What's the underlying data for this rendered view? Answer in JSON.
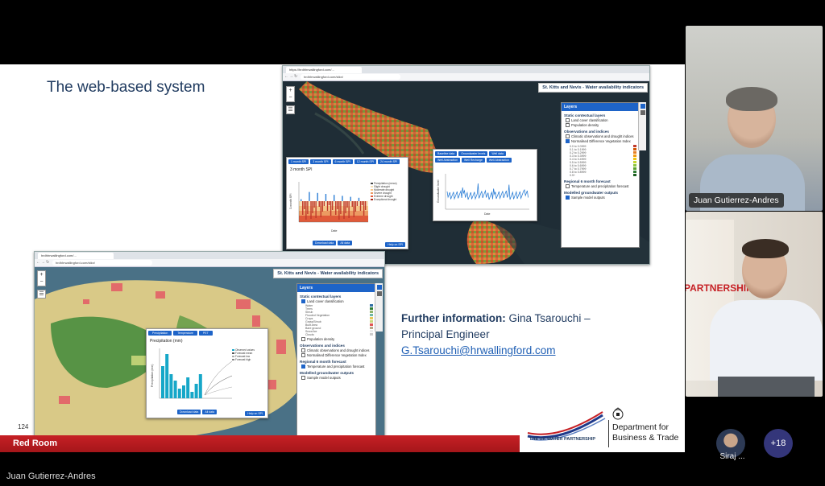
{
  "slide": {
    "title": "The web-based system",
    "page_number": "124",
    "room_label": "Red Room",
    "further_label": "Further information:",
    "contact_name": "Gina Tsarouchi –",
    "contact_role": "Principal Engineer",
    "contact_email": "G.Tsarouchi@hrwallingford.com",
    "logo_ukwp": "THE UK WATER PARTNERSHIP",
    "logo_dbt_line1": "Department for",
    "logo_dbt_line2": "Business & Trade"
  },
  "screenshot_top": {
    "tab_title": "https://hrdhhrwallingford.com/...",
    "url": "hrdhhrwallingford.com/stkn/",
    "header": "St. Kitts and Nevis - Water availability indicators",
    "layers_title": "Layers",
    "sections": [
      {
        "title": "Static contextual layers",
        "items": [
          "Land cover classification",
          "Population density"
        ]
      },
      {
        "title": "Observations and indices",
        "items": [
          "Climatic observations and drought indices",
          "Normalised Difference Vegetation Index"
        ]
      },
      {
        "title": "Regional 6 month forecast",
        "items": [
          "Temperature and precipitation forecast"
        ]
      },
      {
        "title": "Modelled groundwater outputs",
        "items": [
          "Sample model outputs"
        ]
      }
    ],
    "legend": [
      "0.0 to 0.0999",
      "0.1 to 0.1999",
      "0.2 to 0.2999",
      "0.3 to 0.3999",
      "0.4 to 0.4999",
      "0.5 to 0.5999",
      "0.6 to 0.6999",
      "0.7 to 0.7999",
      "0.8 to 0.8999",
      "0.9+"
    ],
    "legend_colors": [
      "#c0392b",
      "#d35400",
      "#e67e22",
      "#f39c12",
      "#f1c40f",
      "#c5d62e",
      "#8cc63f",
      "#5aa02c",
      "#2e7d32",
      "#1b5e20"
    ],
    "spi_buttons": [
      "1 month SPI",
      "3 month SPI",
      "6 month SPI",
      "12 month SPI",
      "24 month SPI"
    ],
    "spi_title": "3 month SPI",
    "spi_legend": [
      "Precipitation (mean)",
      "Slight drought",
      "Moderate drought",
      "Severe drought",
      "Extreme drought",
      "Exceptional drought"
    ],
    "spi_footer": [
      "Download data",
      "All data",
      "Help on SPI"
    ],
    "spi_xlabel": "Date",
    "spi_ylabel": "3-month SPI",
    "gw_buttons": [
      "Baseline data",
      "Groundwater levels",
      "Well data",
      "Well Abstraction",
      "Well Recharge",
      "Well Abstraction"
    ],
    "gw_xlabel": "Date",
    "gw_ylabel": "Groundwater level"
  },
  "screenshot_bottom": {
    "tab_title": "hrdhhrwallingford.com/...",
    "url": "hrdhhrwallingford.com/stkn/",
    "header": "St. Kitts and Nevis - Water availability indicators",
    "layers_title": "Layers",
    "sections": [
      {
        "title": "Static contextual layers",
        "items": [
          "Land cover classification",
          "Population density"
        ]
      },
      {
        "title": "Observations and indices",
        "items": [
          "Climatic observations and drought indices",
          "Normalised Difference Vegetation Index"
        ]
      },
      {
        "title": "Regional 6 month forecast",
        "items": [
          "Temperature and precipitation forecast"
        ]
      },
      {
        "title": "Modelled groundwater outputs",
        "items": [
          "Sample model outputs"
        ]
      }
    ],
    "landcover_legend": [
      "Water",
      "Trees",
      "Shrub",
      "Flooded Vegetation",
      "Crops",
      "Grass/Shrub",
      "Built Area",
      "Bare ground",
      "Snow/Ice",
      "Clouds"
    ],
    "landcover_colors": [
      "#2f6ea3",
      "#2e7d32",
      "#8fb36a",
      "#6fb7a5",
      "#e6c85a",
      "#c9d77b",
      "#e05353",
      "#b9a88a",
      "#eeeeee",
      "#cccccc"
    ],
    "fc_buttons": [
      "Precipitation",
      "Temperature",
      "PET"
    ],
    "fc_title": "Precipitation (mm)",
    "fc_legend": [
      "Observed values",
      "Forecast mean",
      "Forecast low",
      "Forecast high"
    ],
    "fc_footer": [
      "Download data",
      "All data",
      "Help on SPI"
    ],
    "fc_ylabel": "Precipitation (mm)"
  },
  "participants": {
    "speaker_top": "Juan Gutierrez-Andres",
    "speaker_bottom_partial": "PARTNERSHIP",
    "active_speaker": "Juan Gutierrez-Andres",
    "small_avatar_label": "Siraj ...",
    "more_count": "+18"
  }
}
